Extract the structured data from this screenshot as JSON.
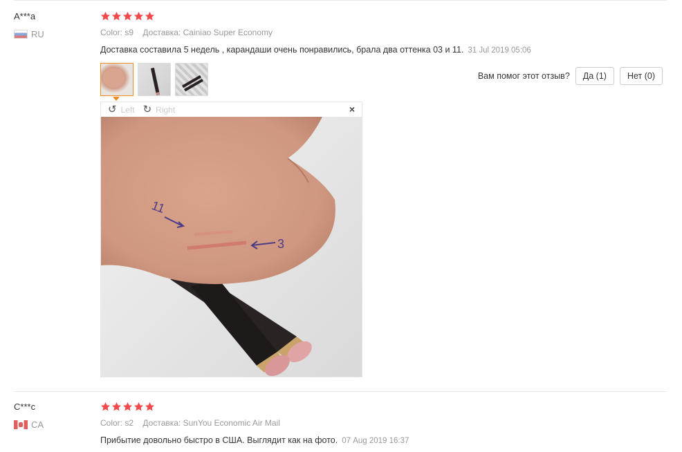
{
  "reviews": [
    {
      "user": "A***a",
      "country_code": "RU",
      "rating": 5,
      "color_label": "Color:",
      "color_value": "s9",
      "shipping_label": "Доставка:",
      "shipping_value": "Cainiao Super Economy",
      "text": "Доставка составила 5 недель , карандаши очень понравились, брала два оттенка 03 и 11.",
      "date": "31 Jul 2019 05:06",
      "helpful_question": "Вам помог этот отзыв?",
      "yes_label": "Да (1)",
      "no_label": "Нет (0)",
      "viewer": {
        "rotate_left": "Left",
        "rotate_right": "Right",
        "close": "×",
        "photo_annotations": [
          "11",
          "3"
        ]
      }
    },
    {
      "user": "C***c",
      "country_code": "CA",
      "rating": 5,
      "color_label": "Color:",
      "color_value": "s2",
      "shipping_label": "Доставка:",
      "shipping_value": "SunYou Economic Air Mail",
      "text": "Прибытие довольно быстро в США. Выглядит как на фото.",
      "date": "07 Aug 2019 16:37"
    }
  ],
  "colors": {
    "star": "#f0494b",
    "active_thumb_border": "#f08a24",
    "muted_text": "#999999"
  },
  "icons": [
    "star-icon",
    "rotate-left-icon",
    "rotate-right-icon",
    "close-icon",
    "flag-ru-icon",
    "flag-ca-icon"
  ]
}
